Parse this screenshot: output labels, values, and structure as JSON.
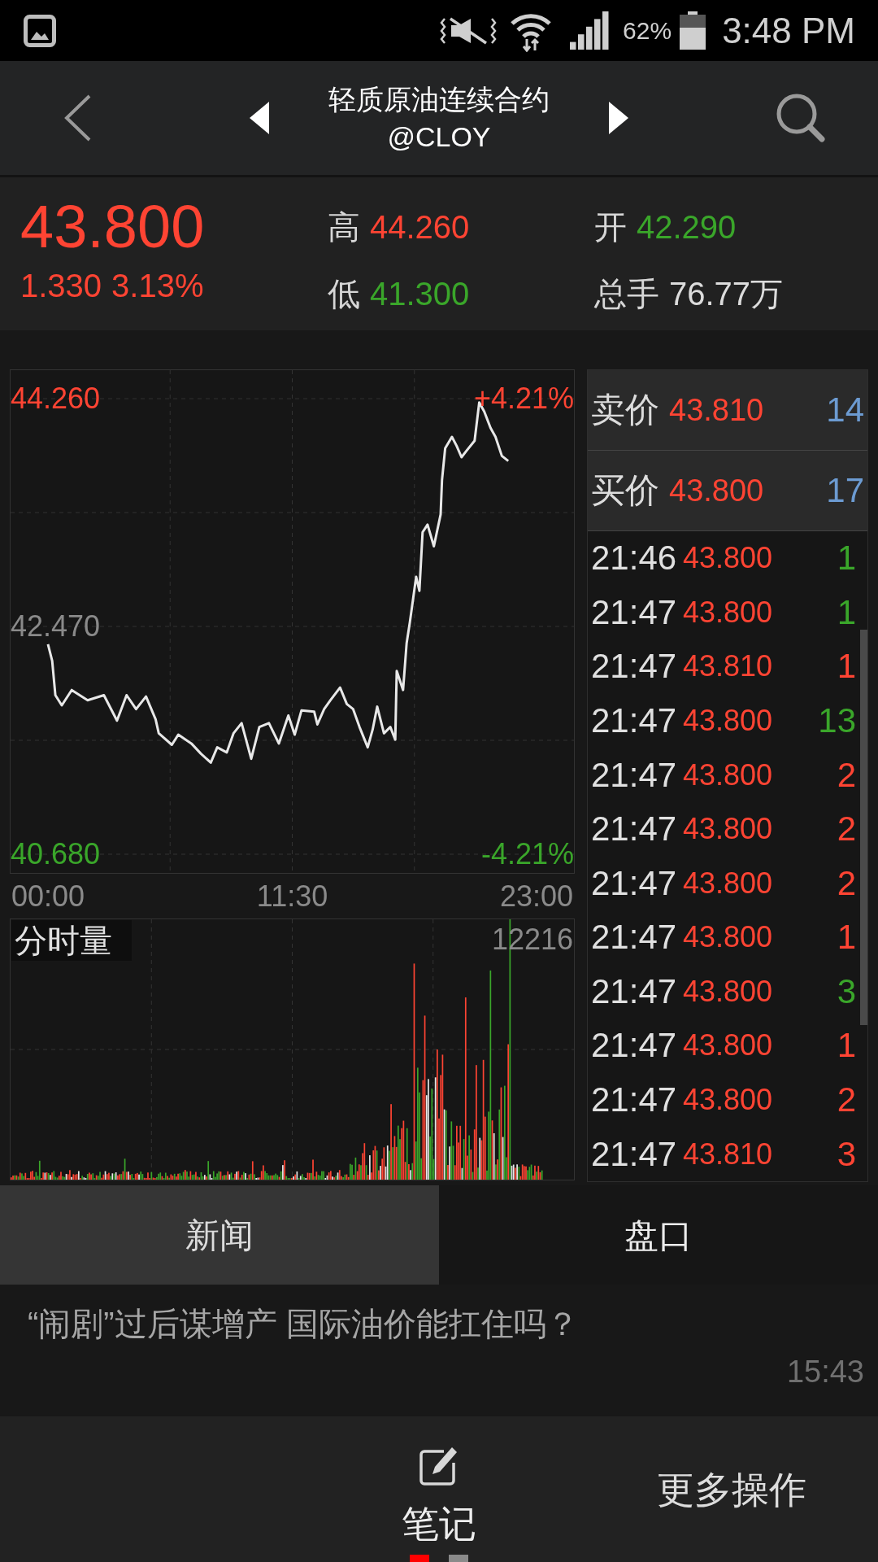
{
  "status_bar": {
    "battery": "62%",
    "time": "3:48 PM"
  },
  "header": {
    "title": "轻质原油连续合约",
    "symbol": "@CLOY"
  },
  "quote": {
    "rising": true,
    "price": "43.800",
    "change": "1.330",
    "change_pct": "3.13%",
    "stats": [
      {
        "label": "高",
        "value": "44.260",
        "color": "#ff4433"
      },
      {
        "label": "低",
        "value": "41.300",
        "color": "#3aa62a"
      },
      {
        "label": "开",
        "value": "42.290",
        "color": "#3aa62a"
      },
      {
        "label": "总手",
        "value": "76.77万",
        "color": "#dcdcdc"
      }
    ]
  },
  "price_chart": {
    "chart_data": {
      "type": "line",
      "x": [
        0,
        12,
        21,
        39,
        67,
        112,
        158,
        195,
        222,
        249,
        277,
        304,
        313,
        350,
        368,
        405,
        432,
        460,
        478,
        505,
        524,
        547,
        574,
        597,
        624,
        652,
        679,
        697,
        716,
        752,
        761,
        780,
        798,
        825,
        844,
        862,
        880,
        903,
        917,
        930,
        949,
        967,
        981,
        985,
        1003,
        1013,
        1022,
        1040,
        1049,
        1058,
        1072,
        1090,
        1109,
        1113,
        1122,
        1141,
        1154,
        1168,
        1182,
        1205,
        1218,
        1232,
        1250,
        1264,
        1282,
        1300
      ],
      "values": [
        42.33,
        42.2,
        41.93,
        41.85,
        41.97,
        41.89,
        41.93,
        41.73,
        41.93,
        41.82,
        41.92,
        41.74,
        41.63,
        41.54,
        41.62,
        41.55,
        41.47,
        41.4,
        41.52,
        41.48,
        41.63,
        41.71,
        41.43,
        41.68,
        41.71,
        41.55,
        41.77,
        41.62,
        41.81,
        41.8,
        41.7,
        41.82,
        41.89,
        41.99,
        41.86,
        41.82,
        41.68,
        41.52,
        41.66,
        41.84,
        41.63,
        41.68,
        41.58,
        42.12,
        41.97,
        42.34,
        42.5,
        42.86,
        42.75,
        43.21,
        43.27,
        43.1,
        43.35,
        43.62,
        43.87,
        43.96,
        43.89,
        43.8,
        43.85,
        43.93,
        44.23,
        44.16,
        44.03,
        43.96,
        43.81,
        43.77
      ],
      "xlim": [
        -105.6,
        1485.6
      ],
      "ylim": [
        40.533,
        44.484
      ],
      "xticks": [
        {
          "value": 0,
          "label": "00:00"
        },
        {
          "value": 690,
          "label": "11:30"
        },
        {
          "value": 1380,
          "label": "23:00"
        }
      ],
      "yticks": [
        {
          "value": 44.26,
          "label": "44.260"
        },
        {
          "value": 42.47,
          "label": "42.470"
        },
        {
          "value": 40.68,
          "label": "40.680"
        }
      ],
      "grid": true
    },
    "upper_pct": "+4.21%",
    "lower_pct": "-4.21%"
  },
  "volume_chart": {
    "title": "分时量",
    "max_label": "12216"
  },
  "order_book": [
    {
      "label": "卖价",
      "price": "43.810",
      "qty": "14"
    },
    {
      "label": "买价",
      "price": "43.800",
      "qty": "17"
    }
  ],
  "trades": [
    {
      "time": "21:46",
      "price": "43.800",
      "qty": "1",
      "color": "#3aa62a"
    },
    {
      "time": "21:47",
      "price": "43.800",
      "qty": "1",
      "color": "#3aa62a"
    },
    {
      "time": "21:47",
      "price": "43.810",
      "qty": "1",
      "color": "#ff4433"
    },
    {
      "time": "21:47",
      "price": "43.800",
      "qty": "13",
      "color": "#3aa62a"
    },
    {
      "time": "21:47",
      "price": "43.800",
      "qty": "2",
      "color": "#ff4433"
    },
    {
      "time": "21:47",
      "price": "43.800",
      "qty": "2",
      "color": "#ff4433"
    },
    {
      "time": "21:47",
      "price": "43.800",
      "qty": "2",
      "color": "#ff4433"
    },
    {
      "time": "21:47",
      "price": "43.800",
      "qty": "1",
      "color": "#ff4433"
    },
    {
      "time": "21:47",
      "price": "43.800",
      "qty": "3",
      "color": "#3aa62a"
    },
    {
      "time": "21:47",
      "price": "43.800",
      "qty": "1",
      "color": "#ff4433"
    },
    {
      "time": "21:47",
      "price": "43.800",
      "qty": "2",
      "color": "#ff4433"
    },
    {
      "time": "21:47",
      "price": "43.810",
      "qty": "3",
      "color": "#ff4433"
    }
  ],
  "tabs": [
    {
      "label": "新闻",
      "selected": true
    },
    {
      "label": "盘口",
      "selected": false
    }
  ],
  "news": [
    {
      "headline": "“闹剧”过后谋增产 国际油价能扛住吗？",
      "time": "15:43"
    }
  ],
  "bottom_bar": {
    "notes_label": "笔记",
    "more_label": "更多操作",
    "page_dots": [
      {
        "selected": true
      },
      {
        "selected": false
      }
    ]
  }
}
